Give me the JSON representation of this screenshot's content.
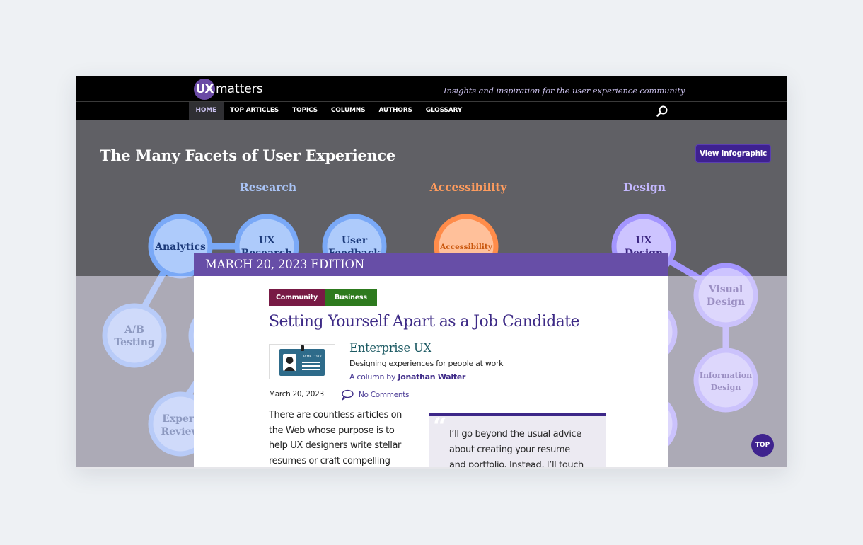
{
  "site": {
    "logo_mark": "UX",
    "logo_text": "matters",
    "tagline": "Insights and inspiration for the user experience community"
  },
  "nav": {
    "items": [
      {
        "label": "HOME",
        "active": true
      },
      {
        "label": "TOP ARTICLES",
        "active": false
      },
      {
        "label": "TOPICS",
        "active": false
      },
      {
        "label": "COLUMNS",
        "active": false
      },
      {
        "label": "AUTHORS",
        "active": false
      },
      {
        "label": "GLOSSARY",
        "active": false
      }
    ],
    "search_icon": "search-icon"
  },
  "hero": {
    "title": "The Many Facets of User Experience",
    "button_label": "View Infographic",
    "categories": [
      {
        "label": "Research",
        "color": "#a9c3f5"
      },
      {
        "label": "Accessibility",
        "color": "#ff9c5e"
      },
      {
        "label": "Design",
        "color": "#c4b8ff"
      }
    ],
    "nodes": {
      "analytics": "Analytics",
      "ux_research": [
        "UX",
        "Research"
      ],
      "user_feedback": [
        "User",
        "Feedback"
      ],
      "accessibility": "Accessibility",
      "ux_design": [
        "UX",
        "Design"
      ],
      "ab_testing": [
        "A/B",
        "Testing"
      ],
      "expert_review": [
        "Expert",
        "Review"
      ],
      "visual_design": [
        "Visual",
        "Design"
      ],
      "information_design": [
        "Information",
        "Design"
      ]
    },
    "colors": {
      "research_ring": "#7aa9f7",
      "research_fill": "#aecbfb",
      "research_text": "#1c3a7a",
      "access_ring": "#ff8c4a",
      "access_fill": "#ffc09a",
      "access_text": "#c9560c",
      "design_ring": "#a496ff",
      "design_fill": "#cdc4ff",
      "design_text": "#3b2580"
    }
  },
  "modal": {
    "edition": "MARCH 20, 2023 EDITION",
    "tags": [
      "Community",
      "Business"
    ],
    "title": "Setting Yourself Apart as a Job Candidate",
    "column": {
      "name": "Enterprise UX",
      "description": "Designing experiences for people at work",
      "by_prefix": "A column by",
      "author": "Jonathan Walter",
      "thumb_label": "ACME CORP"
    },
    "date": "March 20, 2023",
    "comments": "No Comments",
    "body_lines": [
      "There are countless articles on",
      "the Web whose purpose is to",
      "help UX designers write stellar",
      "resumes or craft compelling"
    ],
    "quote_mark": "“",
    "quote_lines": [
      "I’ll go beyond the usual advice",
      "about creating your resume",
      "and portfolio. Instead, I’ll touch"
    ]
  },
  "top_button": "TOP"
}
